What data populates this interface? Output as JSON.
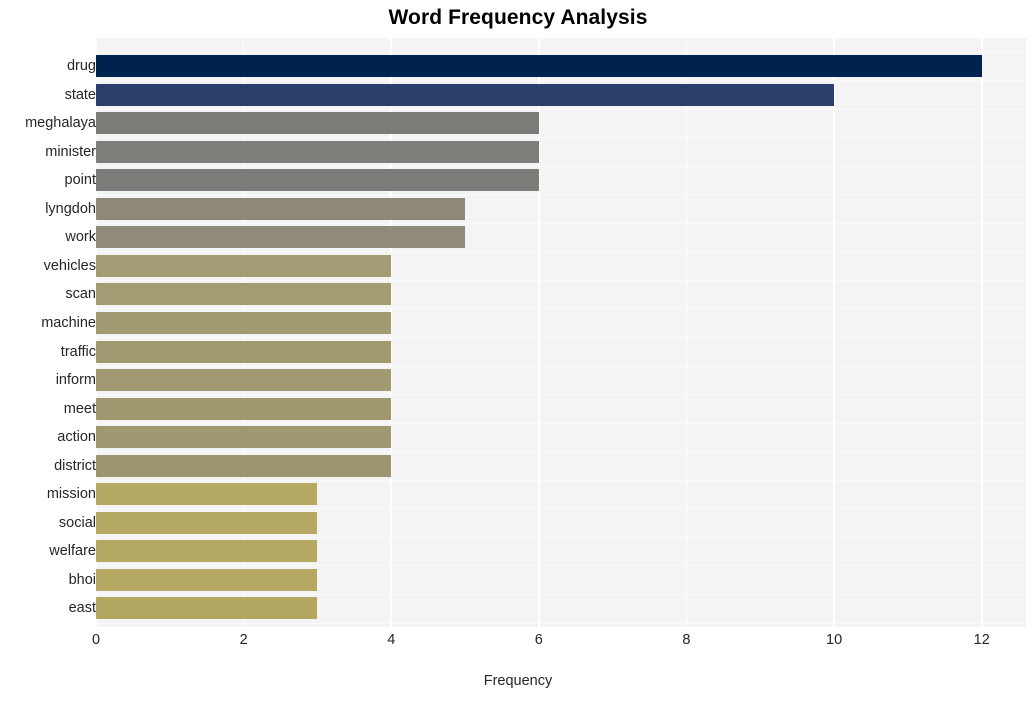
{
  "chart_data": {
    "type": "bar",
    "orientation": "horizontal",
    "title": "Word Frequency Analysis",
    "xlabel": "Frequency",
    "ylabel": "",
    "categories": [
      "drug",
      "state",
      "meghalaya",
      "minister",
      "point",
      "lyngdoh",
      "work",
      "vehicles",
      "scan",
      "machine",
      "traffic",
      "inform",
      "meet",
      "action",
      "district",
      "mission",
      "social",
      "welfare",
      "bhoi",
      "east"
    ],
    "values": [
      12,
      10,
      6,
      6,
      6,
      5,
      5,
      4,
      4,
      4,
      4,
      4,
      4,
      4,
      4,
      3,
      3,
      3,
      3,
      3
    ],
    "xlim": [
      0,
      12.6
    ],
    "xticks": [
      0,
      2,
      4,
      6,
      8,
      10,
      12
    ],
    "xtick_labels": [
      "0",
      "2",
      "4",
      "6",
      "8",
      "10",
      "12"
    ],
    "grid": true,
    "grid_color": "#ffffff",
    "legend": null,
    "plot_background": "#f4f4f5",
    "figure_background": "#ffffff",
    "bar_colors": [
      "#00224e",
      "#2c3f6b",
      "#7b7b78",
      "#7e7d79",
      "#7c7b77",
      "#8e8877",
      "#908a78",
      "#a39c74",
      "#a39c73",
      "#a29b72",
      "#a19a71",
      "#a09971",
      "#a09970",
      "#9f9870",
      "#9c9570",
      "#b5a963",
      "#b5a963",
      "#b4a862",
      "#b4a862",
      "#b3a762"
    ]
  }
}
